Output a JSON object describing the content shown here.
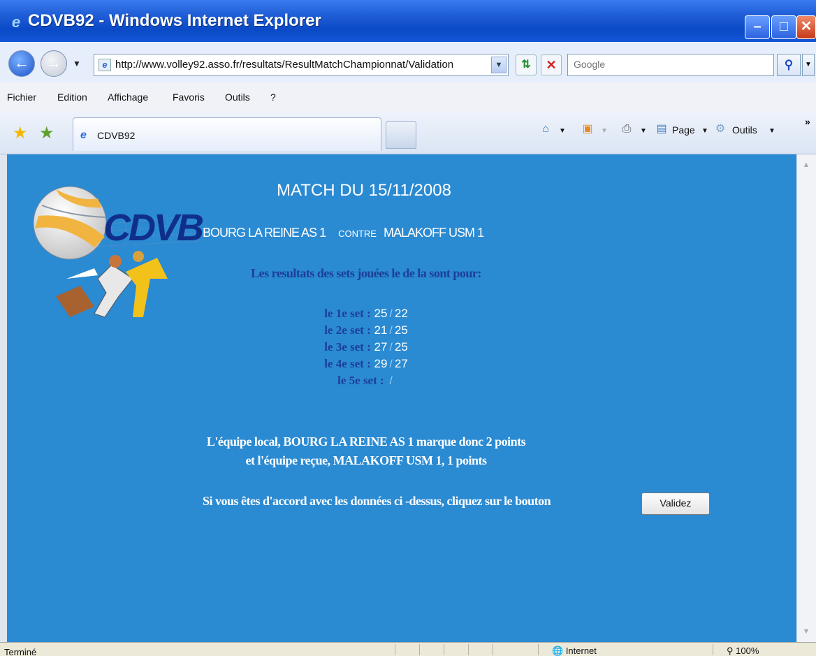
{
  "window": {
    "title": "CDVB92 - Windows Internet Explorer",
    "minimize": "–",
    "maximize": "□",
    "close": "✕"
  },
  "address_bar": {
    "url": "http://www.volley92.asso.fr/resultats/ResultMatchChampionnat/Validation",
    "search_placeholder": "Google"
  },
  "menu": {
    "items": [
      "Fichier",
      "Edition",
      "Affichage",
      "Favoris",
      "Outils",
      "?"
    ]
  },
  "tabs": {
    "active_label": "CDVB92",
    "commands": {
      "page": "Page",
      "tools": "Outils"
    }
  },
  "content": {
    "logo_text": "CDVB 92",
    "match_label": "MATCH DU",
    "match_date": "15/11/2008",
    "home_team": "BOURG LA REINE AS 1",
    "vs_label": "CONTRE",
    "away_team": "MALAKOFF USM 1",
    "intro": "Les resultats des sets jouées le de la sont pour:",
    "sets": [
      {
        "label": "le 1e set :",
        "home": "25",
        "away": "22"
      },
      {
        "label": "le 2e set :",
        "home": "21",
        "away": "25"
      },
      {
        "label": "le 3e set :",
        "home": "27",
        "away": "25"
      },
      {
        "label": "le 4e set :",
        "home": "29",
        "away": "27"
      },
      {
        "label": "le 5e set :",
        "home": "",
        "away": ""
      }
    ],
    "summary_line1": "L'équipe local, BOURG LA REINE AS 1 marque donc 2 points",
    "summary_line2": "et l'équipe reçue, MALAKOFF USM 1, 1 points",
    "confirm_text": "Si vous êtes d'accord avec les données ci   -dessus, cliquez sur le bouton",
    "validate_button": "Validez"
  },
  "status_bar": {
    "text": "Terminé",
    "zone": "Internet",
    "zoom": "100%"
  },
  "colors": {
    "content_background": "#2a8ad2",
    "intro_text": "#1d3f97",
    "title_bar": "#0b4ac6"
  }
}
